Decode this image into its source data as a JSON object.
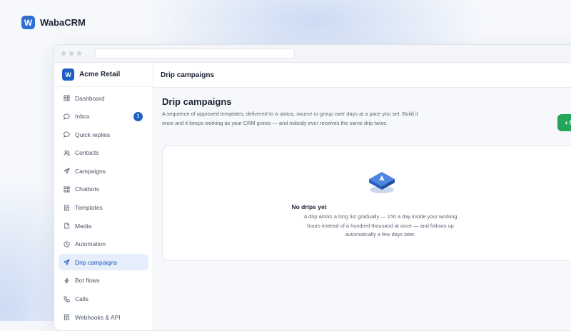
{
  "brand": {
    "logo_letter": "W",
    "name": "WabaCRM"
  },
  "workspace": {
    "logo_letter": "W",
    "name": "Acme Retail"
  },
  "sidebar": {
    "items": [
      {
        "label": "Dashboard",
        "icon": "dashboard-icon"
      },
      {
        "label": "Inbox",
        "icon": "chat-icon",
        "badge": "3"
      },
      {
        "label": "Quick replies",
        "icon": "chat-icon"
      },
      {
        "label": "Contacts",
        "icon": "users-icon"
      },
      {
        "label": "Campaigns",
        "icon": "send-icon"
      },
      {
        "label": "Chatbots",
        "icon": "grid-icon"
      },
      {
        "label": "Templates",
        "icon": "document-icon"
      },
      {
        "label": "Media",
        "icon": "file-icon"
      },
      {
        "label": "Automation",
        "icon": "clock-icon"
      },
      {
        "label": "Drip campaigns",
        "icon": "send-icon",
        "active": true
      },
      {
        "label": "Bot flows",
        "icon": "bolt-icon"
      },
      {
        "label": "Calls",
        "icon": "phone-icon"
      },
      {
        "label": "Webhooks & API",
        "icon": "document-icon"
      }
    ]
  },
  "header": {
    "title": "Drip campaigns"
  },
  "main": {
    "title": "Drip campaigns",
    "description": "A sequence of approved templates, delivered to a status, source or group over days at a pace you set. Build it once and it keeps working as your CRM grows — and nobody ever receives the same drip twice.",
    "new_button_label": "+ N",
    "empty_state": {
      "icon": "drip-send-icon",
      "title": "No drips yet",
      "text": "A drip works a long list gradually — 150 a day inside your working hours instead of a hundred thousand at once — and follows up automatically a few days later."
    }
  },
  "colors": {
    "brand_blue": "#2f6fd2",
    "active_nav_bg": "#e6eefb",
    "active_nav_text": "#1f56b8",
    "primary_button": "#23a55a"
  }
}
